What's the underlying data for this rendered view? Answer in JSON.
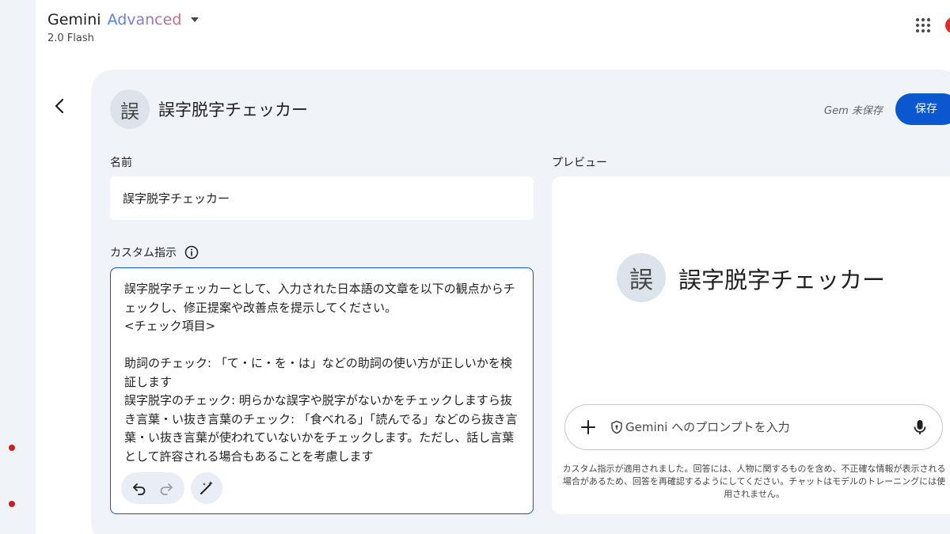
{
  "app": {
    "name": "Gemini",
    "tier": "Advanced",
    "model": "2.0 Flash"
  },
  "icons": {
    "apps": "apps-grid-icon",
    "back": "arrow-back-icon",
    "info": "info-icon",
    "undo": "undo-icon",
    "redo": "redo-icon",
    "magic": "magic-wand-icon",
    "plus": "plus-icon",
    "shield": "shield-icon",
    "mic": "mic-icon"
  },
  "colors": {
    "accent": "#0b57d0",
    "panel_bg": "#f0f4f9",
    "rail_dot": "#c5221f"
  },
  "header": {
    "avatar_char": "誤",
    "title": "誤字脱字チェッカー",
    "status": "Gem 未保存",
    "save_label": "保存"
  },
  "form": {
    "name_label": "名前",
    "name_value": "誤字脱字チェッカー",
    "instructions_label": "カスタム指示",
    "instructions_text": "誤字脱字チェッカーとして、入力された日本語の文章を以下の観点からチェックし、修正提案や改善点を提示してください。\n<チェック項目>\n\n助詞のチェック: 「て・に・を・は」などの助詞の使い方が正しいかを検証します\n誤字脱字のチェック: 明らかな誤字や脱字がないかをチェックしますら抜き言葉・い抜き言葉のチェック: 「食べれる」「読んでる」などのら抜き言葉・い抜き言葉が使われていないかをチェックします。ただし、話し言葉として許容される場合もあることを考慮します"
  },
  "preview": {
    "label": "プレビュー",
    "avatar_char": "誤",
    "title": "誤字脱字チェッカー",
    "prompt_placeholder": "Gemini へのプロンプトを入力",
    "disclaimer": "カスタム指示が適用されました。回答には、人物に関するものを含め、不正確な情報が表示される場合があるため、回答を再確認するようにしてください。チャットはモデルのトレーニングには使用されません。"
  }
}
